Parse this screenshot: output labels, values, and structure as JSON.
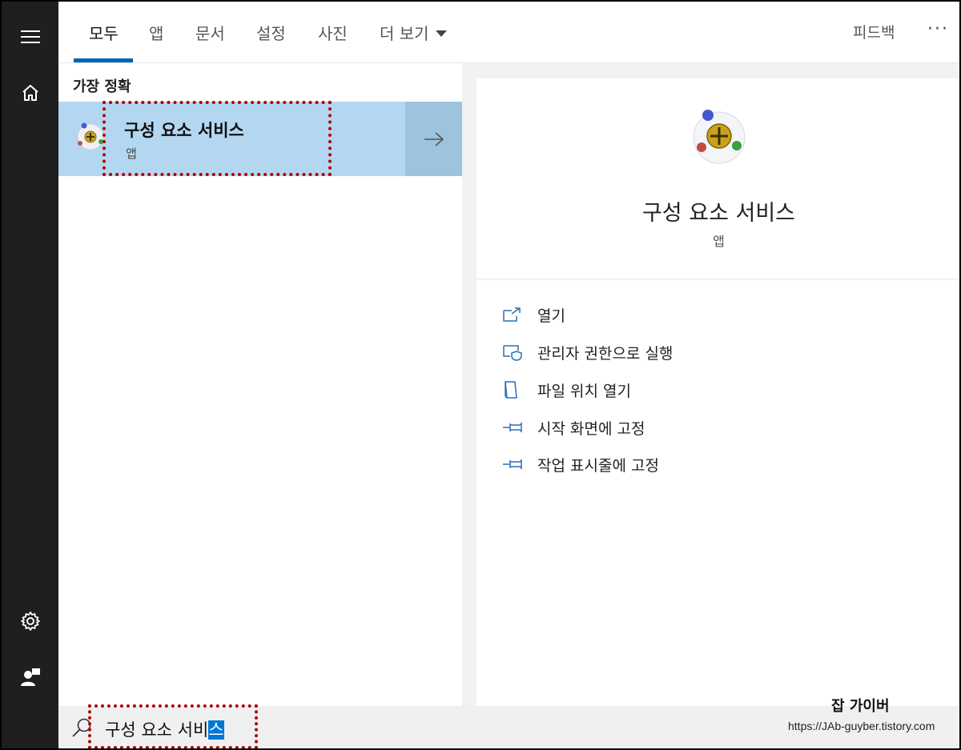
{
  "tabs": [
    {
      "label": "모두",
      "active": true
    },
    {
      "label": "앱"
    },
    {
      "label": "문서"
    },
    {
      "label": "설정"
    },
    {
      "label": "사진"
    },
    {
      "label": "더 보기"
    }
  ],
  "header": {
    "feedback": "피드백",
    "more": "···"
  },
  "results": {
    "heading": "가장 정확",
    "best_match": {
      "title": "구성 요소 서비스",
      "type": "앱"
    }
  },
  "details": {
    "title": "구성 요소 서비스",
    "type": "앱",
    "actions": [
      {
        "label": "열기",
        "icon": "open-icon"
      },
      {
        "label": "관리자 권한으로 실행",
        "icon": "shield-icon"
      },
      {
        "label": "파일 위치 열기",
        "icon": "file-location-icon"
      },
      {
        "label": "시작 화면에 고정",
        "icon": "pin-icon"
      },
      {
        "label": "작업 표시줄에 고정",
        "icon": "pin-icon"
      }
    ]
  },
  "search": {
    "query_prefix": "구성 요소 서비",
    "query_selected": "스"
  },
  "watermark": {
    "title": "잡 가이버",
    "url": "https://JAb-guyber.tistory.com"
  },
  "colors": {
    "accent": "#0063b1",
    "selection": "#b4d7f1",
    "highlight_box": "#b00000",
    "rail": "#1f1f1f"
  }
}
